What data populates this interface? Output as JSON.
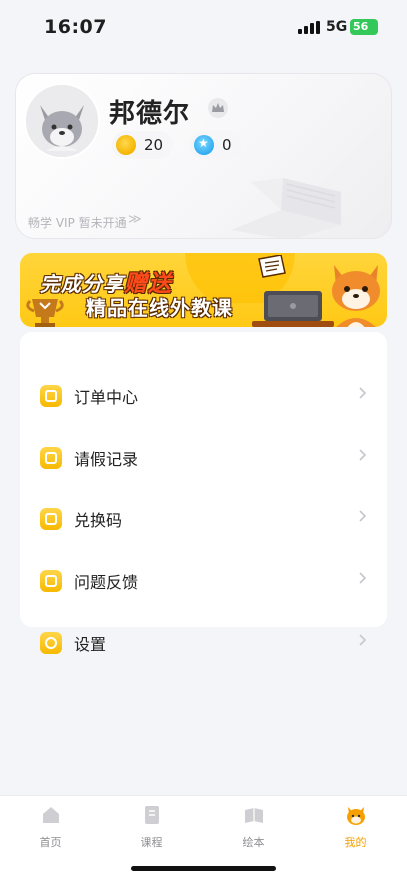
{
  "status_bar": {
    "time": "16:07",
    "network": "5G",
    "battery": "56"
  },
  "profile": {
    "name": "邦德尔",
    "coins": "20",
    "stars": "0",
    "vip_text": "畅学 VIP 暂未开通",
    "vip_arrow": "≫"
  },
  "banner": {
    "line1_prefix": "完成分享",
    "line1_accent": "赠送",
    "line2": "精品在线外教课"
  },
  "menu": {
    "items": [
      {
        "label": "订单中心",
        "icon": "order-icon"
      },
      {
        "label": "请假记录",
        "icon": "leave-record-icon"
      },
      {
        "label": "兑换码",
        "icon": "redeem-code-icon"
      },
      {
        "label": "问题反馈",
        "icon": "feedback-icon"
      },
      {
        "label": "设置",
        "icon": "settings-icon"
      }
    ]
  },
  "tabs": [
    {
      "label": "首页",
      "icon": "home-icon"
    },
    {
      "label": "课程",
      "icon": "course-icon"
    },
    {
      "label": "绘本",
      "icon": "picture-book-icon"
    },
    {
      "label": "我的",
      "icon": "mine-icon",
      "active": true
    }
  ],
  "colors": {
    "accent": "#f7b900",
    "active_tab": "#f5a000",
    "background": "#f4f5f9"
  }
}
